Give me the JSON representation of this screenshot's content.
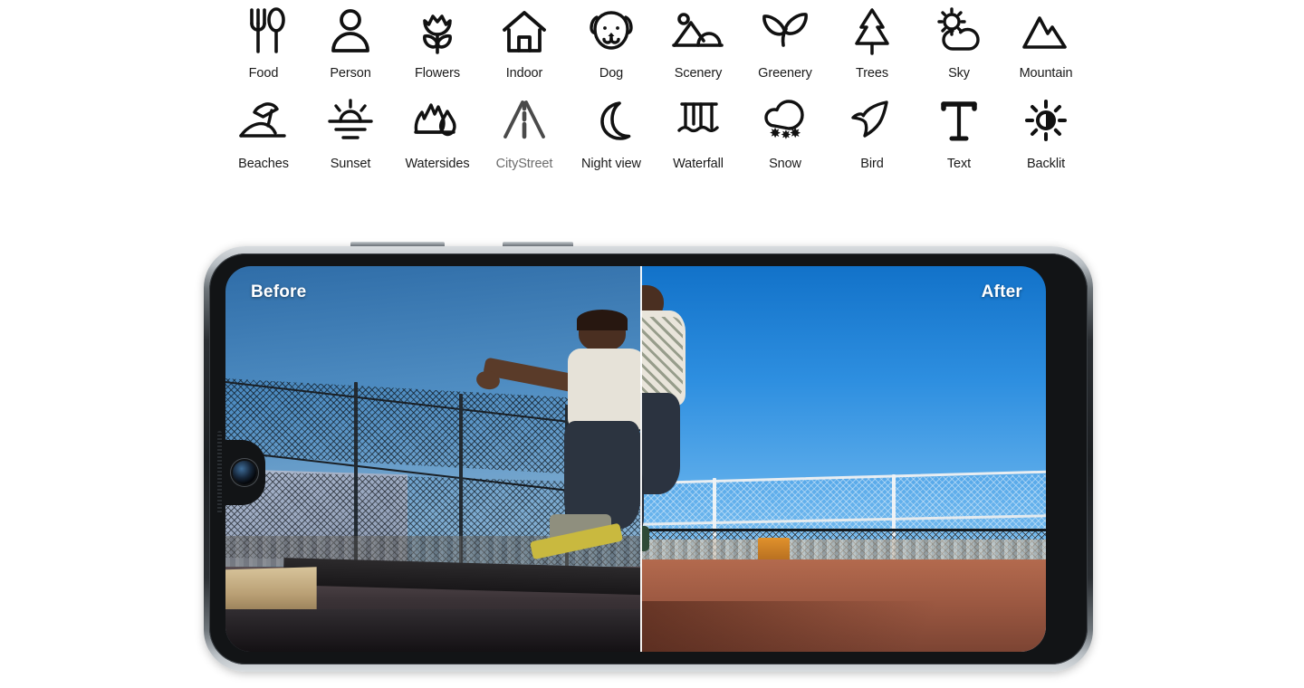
{
  "scene_detection": {
    "rows": [
      [
        {
          "label": "Food",
          "icon": "food-icon",
          "muted": false
        },
        {
          "label": "Person",
          "icon": "person-icon",
          "muted": false
        },
        {
          "label": "Flowers",
          "icon": "flowers-icon",
          "muted": false
        },
        {
          "label": "Indoor",
          "icon": "indoor-icon",
          "muted": false
        },
        {
          "label": "Dog",
          "icon": "dog-icon",
          "muted": false
        },
        {
          "label": "Scenery",
          "icon": "scenery-icon",
          "muted": false
        },
        {
          "label": "Greenery",
          "icon": "greenery-icon",
          "muted": false
        },
        {
          "label": "Trees",
          "icon": "trees-icon",
          "muted": false
        },
        {
          "label": "Sky",
          "icon": "sky-icon",
          "muted": false
        },
        {
          "label": "Mountain",
          "icon": "mountain-icon",
          "muted": false
        }
      ],
      [
        {
          "label": "Beaches",
          "icon": "beaches-icon",
          "muted": false
        },
        {
          "label": "Sunset",
          "icon": "sunset-icon",
          "muted": false
        },
        {
          "label": "Watersides",
          "icon": "watersides-icon",
          "muted": false
        },
        {
          "label": "CityStreet",
          "icon": "citystreet-icon",
          "muted": true
        },
        {
          "label": "Night view",
          "icon": "night-view-icon",
          "muted": false
        },
        {
          "label": "Waterfall",
          "icon": "waterfall-icon",
          "muted": false
        },
        {
          "label": "Snow",
          "icon": "snow-icon",
          "muted": false
        },
        {
          "label": "Bird",
          "icon": "bird-icon",
          "muted": false
        },
        {
          "label": "Text",
          "icon": "text-icon",
          "muted": false
        },
        {
          "label": "Backlit",
          "icon": "backlit-icon",
          "muted": false
        }
      ]
    ]
  },
  "device": {
    "orientation": "landscape",
    "buttons": [
      "power-button",
      "volume-button"
    ],
    "front_camera": "front-camera-lens"
  },
  "comparison": {
    "before_label": "Before",
    "after_label": "After",
    "divider": "before-after-divider"
  },
  "colors": {
    "label_default": "#1a1a1a",
    "label_muted": "#6d6d6d",
    "icon_default": "#111111",
    "icon_muted": "#4a4a4a",
    "page_background": "#ffffff",
    "overlay_text": "#ffffff"
  }
}
